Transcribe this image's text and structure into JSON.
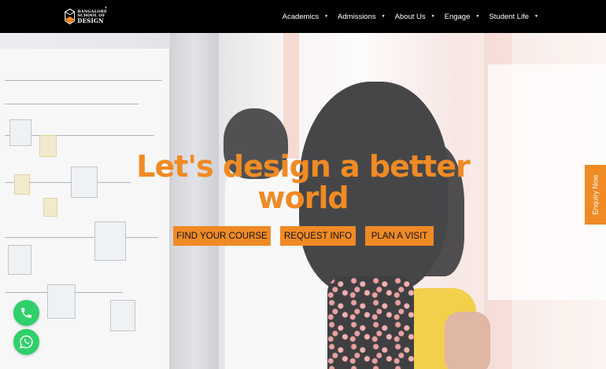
{
  "header": {
    "logo": {
      "line_small_1": "BANGALORE",
      "line_small_2": "SCHOOL OF",
      "line_big": "DESIGN",
      "trademark": "®"
    },
    "nav": [
      {
        "label": "Academics"
      },
      {
        "label": "Admissions"
      },
      {
        "label": "About Us"
      },
      {
        "label": "Engage"
      },
      {
        "label": "Student Life"
      }
    ]
  },
  "hero": {
    "headline_line_1": "Let's design a better",
    "headline_line_2": "world",
    "buttons": {
      "find_course": "FIND YOUR COURSE",
      "request_info": "REQUEST INFO",
      "plan_visit": "PLAN A VISIT"
    }
  },
  "side_tab": {
    "label": "Enquiry Now"
  },
  "floating": {
    "phone_icon": "phone-icon",
    "whatsapp_icon": "whatsapp-icon"
  },
  "colors": {
    "accent": "#f08a24",
    "header_bg": "#000000",
    "fab_green": "#2fd06a"
  }
}
